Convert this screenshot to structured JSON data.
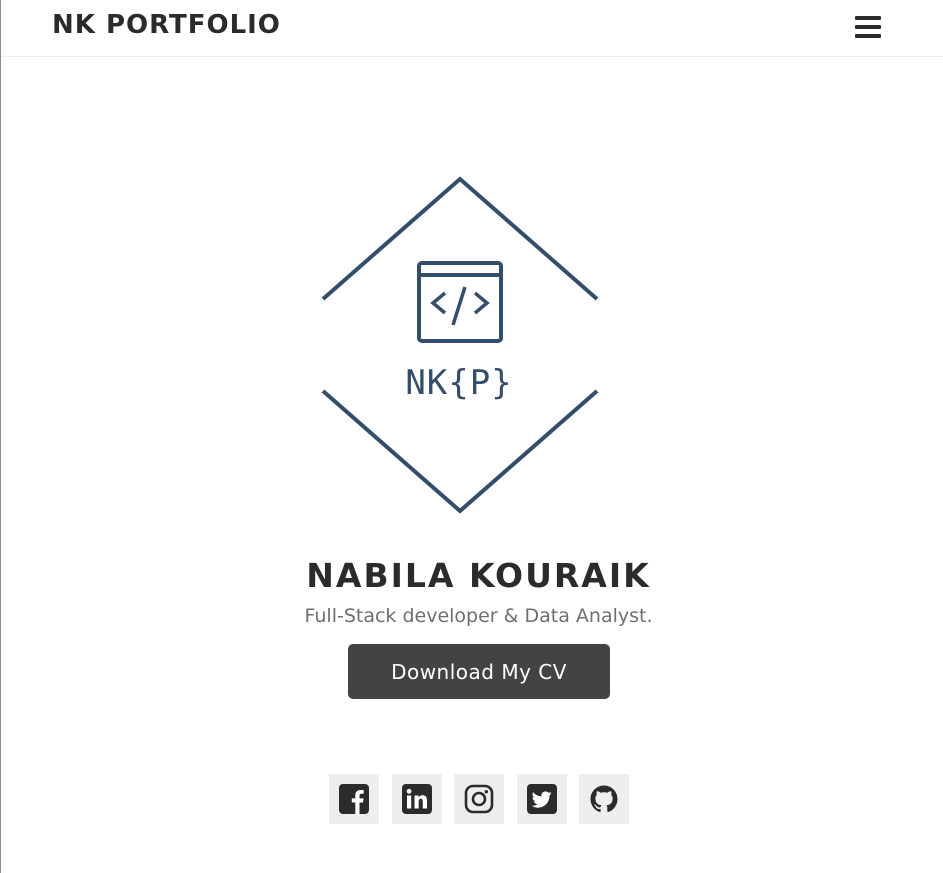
{
  "navbar": {
    "brand": "NK PORTFOLIO",
    "menu_icon": "hamburger-menu-icon"
  },
  "logo": {
    "icon": "code-window-icon",
    "code_glyph": "</>",
    "text": "NK{P}",
    "color": "#334e6b"
  },
  "hero": {
    "name": "NABILA KOURAIK",
    "subtitle": "Full-Stack developer & Data Analyst.",
    "cv_button_label": "Download My CV"
  },
  "social": [
    {
      "network": "facebook",
      "icon": "facebook-icon"
    },
    {
      "network": "linkedin",
      "icon": "linkedin-icon"
    },
    {
      "network": "instagram",
      "icon": "instagram-icon"
    },
    {
      "network": "twitter",
      "icon": "twitter-icon"
    },
    {
      "network": "github",
      "icon": "github-icon"
    }
  ],
  "colors": {
    "text_dark": "#2b2b2b",
    "text_muted": "#6f6f6f",
    "button_bg": "#434343",
    "logo_stroke": "#334e6b",
    "social_bg": "#eeeeee"
  }
}
